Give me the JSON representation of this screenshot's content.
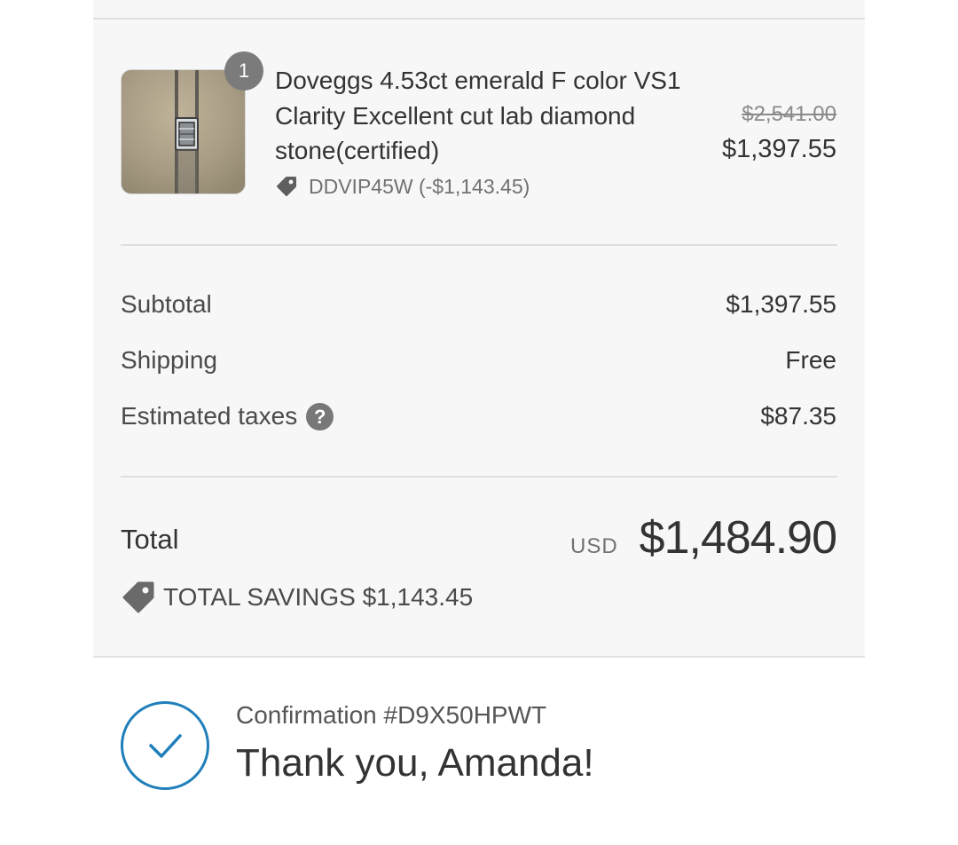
{
  "order_summary": {
    "line_item": {
      "quantity": "1",
      "title": "Doveggs 4.53ct emerald F color VS1 Clarity Excellent cut lab diamond stone(certified)",
      "discount_text": "DDVIP45W (-$1,143.45)",
      "original_price": "$2,541.00",
      "price": "$1,397.55",
      "thumbnail_icon": "diamond-in-tweezers-photo"
    },
    "rows": {
      "subtotal_label": "Subtotal",
      "subtotal_value": "$1,397.55",
      "shipping_label": "Shipping",
      "shipping_value": "Free",
      "taxes_label": "Estimated taxes",
      "taxes_help_icon": "?",
      "taxes_value": "$87.35"
    },
    "total": {
      "label": "Total",
      "currency": "USD",
      "value": "$1,484.90",
      "savings": "TOTAL SAVINGS $1,143.45"
    }
  },
  "confirmation": {
    "number": "Confirmation #D9X50HPWT",
    "thank_you": "Thank you, Amanda!",
    "icon": "check-circle-icon"
  },
  "colors": {
    "summary_background": "#f7f7f7",
    "accent_blue": "#1f7fba",
    "text_primary": "#333333",
    "text_muted": "#717171"
  }
}
